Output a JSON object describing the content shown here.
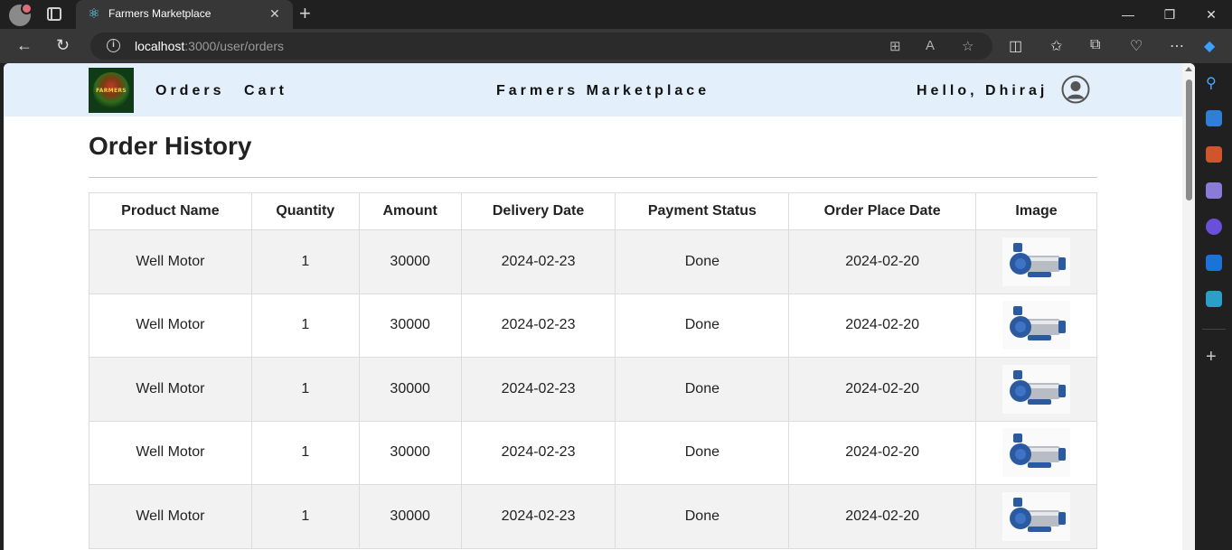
{
  "browser": {
    "tab_title": "Farmers Marketplace",
    "url_host": "localhost",
    "url_path": ":3000/user/orders"
  },
  "header": {
    "nav": [
      "Orders",
      "Cart"
    ],
    "brand": "Farmers Marketplace",
    "greeting": "Hello, Dhiraj",
    "logo_text": "FARMERS"
  },
  "page": {
    "title": "Order History"
  },
  "table": {
    "columns": [
      "Product Name",
      "Quantity",
      "Amount",
      "Delivery Date",
      "Payment Status",
      "Order Place Date",
      "Image"
    ],
    "rows": [
      [
        "Well Motor",
        "1",
        "30000",
        "2024-02-23",
        "Done",
        "2024-02-20"
      ],
      [
        "Well Motor",
        "1",
        "30000",
        "2024-02-23",
        "Done",
        "2024-02-20"
      ],
      [
        "Well Motor",
        "1",
        "30000",
        "2024-02-23",
        "Done",
        "2024-02-20"
      ],
      [
        "Well Motor",
        "1",
        "30000",
        "2024-02-23",
        "Done",
        "2024-02-20"
      ],
      [
        "Well Motor",
        "1",
        "30000",
        "2024-02-23",
        "Done",
        "2024-02-20"
      ]
    ],
    "image_icon": "water-pump-motor-image"
  },
  "colors": {
    "header_bg": "#e3f0fb",
    "row_striped": "#f2f2f2"
  }
}
